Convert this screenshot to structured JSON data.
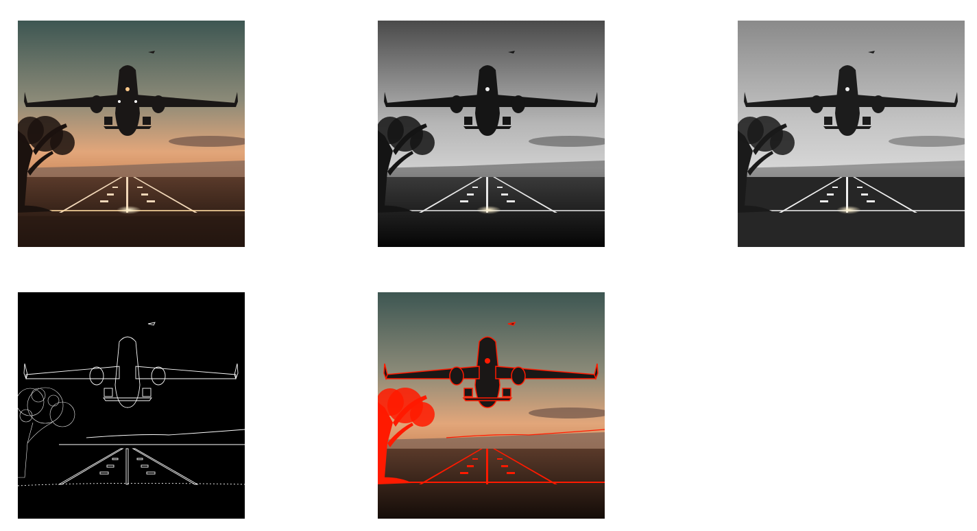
{
  "panels": [
    {
      "id": "original",
      "style": "color"
    },
    {
      "id": "grayscale",
      "style": "gray"
    },
    {
      "id": "grayscale-equalized",
      "style": "gray-flat"
    },
    {
      "id": "canny-edges",
      "style": "edges"
    },
    {
      "id": "edges-overlay",
      "style": "overlay"
    }
  ],
  "colors": {
    "background": "#ffffff",
    "edge": "#ffffff",
    "overlay": "#ff1a00"
  }
}
